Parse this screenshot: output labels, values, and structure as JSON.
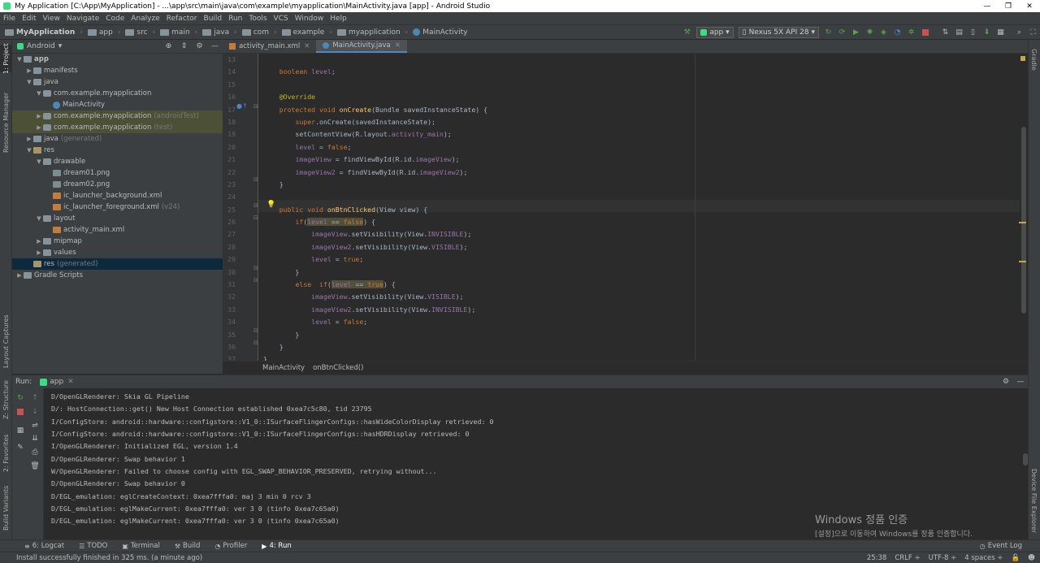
{
  "window": {
    "title": "My Application [C:\\App\\MyApplication] - ...\\app\\src\\main\\java\\com\\example\\myapplication\\MainActivity.java [app] - Android Studio"
  },
  "menu": [
    "File",
    "Edit",
    "View",
    "Navigate",
    "Code",
    "Analyze",
    "Refactor",
    "Build",
    "Run",
    "Tools",
    "VCS",
    "Window",
    "Help"
  ],
  "breadcrumbs": [
    "MyApplication",
    "app",
    "src",
    "main",
    "java",
    "com",
    "example",
    "myapplication",
    "MainActivity"
  ],
  "toolbar": {
    "run_config": "app",
    "device": "Nexus 5X API 28"
  },
  "left_tabs": [
    "1: Project",
    "Resource Manager",
    "Layout Captures",
    "Z: Structure",
    "2: Favorites",
    "Build Variants"
  ],
  "right_tabs": [
    "Gradle",
    "Device File Explorer"
  ],
  "project": {
    "view_mode": "Android",
    "tree": [
      {
        "label": "app",
        "depth": 0,
        "arrow": "▼",
        "icon": "folder",
        "bold": true
      },
      {
        "label": "manifests",
        "depth": 1,
        "arrow": "▶",
        "icon": "folder"
      },
      {
        "label": "java",
        "depth": 1,
        "arrow": "▼",
        "icon": "folder"
      },
      {
        "label": "com.example.myapplication",
        "depth": 2,
        "arrow": "▼",
        "icon": "pkg"
      },
      {
        "label": "MainActivity",
        "depth": 3,
        "arrow": "",
        "icon": "java"
      },
      {
        "label": "com.example.myapplication",
        "depth": 2,
        "arrow": "▶",
        "icon": "pkg",
        "suffix": "(androidTest)",
        "tinted": true
      },
      {
        "label": "com.example.myapplication",
        "depth": 2,
        "arrow": "▶",
        "icon": "pkg",
        "suffix": "(test)",
        "tinted": true
      },
      {
        "label": "java",
        "depth": 1,
        "arrow": "▶",
        "icon": "folder",
        "suffix": "(generated)"
      },
      {
        "label": "res",
        "depth": 1,
        "arrow": "▼",
        "icon": "res"
      },
      {
        "label": "drawable",
        "depth": 2,
        "arrow": "▼",
        "icon": "folder"
      },
      {
        "label": "dream01.png",
        "depth": 3,
        "arrow": "",
        "icon": "png"
      },
      {
        "label": "dream02.png",
        "depth": 3,
        "arrow": "",
        "icon": "png"
      },
      {
        "label": "ic_launcher_background.xml",
        "depth": 3,
        "arrow": "",
        "icon": "xml"
      },
      {
        "label": "ic_launcher_foreground.xml",
        "depth": 3,
        "arrow": "",
        "icon": "xml",
        "suffix": "(v24)"
      },
      {
        "label": "layout",
        "depth": 2,
        "arrow": "▼",
        "icon": "folder"
      },
      {
        "label": "activity_main.xml",
        "depth": 3,
        "arrow": "",
        "icon": "xml"
      },
      {
        "label": "mipmap",
        "depth": 2,
        "arrow": "▶",
        "icon": "folder"
      },
      {
        "label": "values",
        "depth": 2,
        "arrow": "▶",
        "icon": "folder"
      },
      {
        "label": "res",
        "depth": 1,
        "arrow": "",
        "icon": "res",
        "suffix": "(generated)",
        "selected": true
      },
      {
        "label": "Gradle Scripts",
        "depth": 0,
        "arrow": "▶",
        "icon": "gradle"
      }
    ]
  },
  "editor_tabs": [
    {
      "label": "activity_main.xml",
      "icon": "xml"
    },
    {
      "label": "MainActivity.java",
      "icon": "java",
      "active": true
    }
  ],
  "editor": {
    "line_numbers": [
      "13",
      "14",
      "15",
      "16",
      "17",
      "18",
      "19",
      "20",
      "21",
      "22",
      "23",
      "24",
      "25",
      "26",
      "27",
      "28",
      "29",
      "30",
      "31",
      "32",
      "33",
      "34",
      "35",
      "36",
      "37"
    ],
    "lines": [
      "",
      "    <span class=\"kw\">boolean</span> <span class=\"fd\">level</span>;",
      "",
      "    <span class=\"an\">@Override</span>",
      "    <span class=\"kw\">protected void</span> <span class=\"fn\">onCreate</span>(Bundle savedInstanceState) {",
      "        <span class=\"kw\">super</span>.onCreate(savedInstanceState);",
      "        setContentView(R.layout.<span class=\"fd\">activity_main</span>);",
      "        <span class=\"fd\">level</span> = <span class=\"kw\">false</span>;",
      "        <span class=\"fd\">imageView</span> = findViewById(R.id.<span class=\"fd\">imageView</span>);",
      "        <span class=\"fd\">imageView2</span> = findViewById(R.id.<span class=\"fd\">imageView2</span>);",
      "    }",
      "",
      "    <span class=\"kw\">public void</span> <span class=\"fn\">onBtnClicked</span>(View view) {",
      "        <span class=\"kw\">if</span>(<span class=\"hl\"><span class=\"fd\">level</span> == <span class=\"kw\">false</span></span>) {",
      "            <span class=\"fd\">imageView</span>.setVisibility(View.<span class=\"fd\">INVISIBLE</span>);",
      "            <span class=\"fd\">imageView2</span>.setVisibility(View.<span class=\"fd\">VISIBLE</span>);",
      "            <span class=\"fd\">level</span> = <span class=\"kw\">true</span>;",
      "        }",
      "        <span class=\"kw\">else</span>  <span class=\"kw\">if</span>(<span class=\"hl\"><span class=\"fd\">level</span> == <span class=\"kw\">true</span></span>) {",
      "            <span class=\"fd\">imageView</span>.setVisibility(View.<span class=\"fd\">VISIBLE</span>);",
      "            <span class=\"fd\">imageView2</span>.setVisibility(View.<span class=\"fd\">INVISIBLE</span>);",
      "            <span class=\"fd\">level</span> = <span class=\"kw\">false</span>;",
      "        }",
      "    }",
      "}"
    ]
  },
  "editor_breadcrumb": [
    "MainActivity",
    "onBtnClicked()"
  ],
  "run_panel": {
    "label": "Run:",
    "tab": "app",
    "log": [
      "D/OpenGLRenderer: Skia GL Pipeline",
      "D/: HostConnection::get() New Host Connection established 0xea7c5c80, tid 23795",
      "I/ConfigStore: android::hardware::configstore::V1_0::ISurfaceFlingerConfigs::hasWideColorDisplay retrieved: 0",
      "I/ConfigStore: android::hardware::configstore::V1_0::ISurfaceFlingerConfigs::hasHDRDisplay retrieved: 0",
      "I/OpenGLRenderer: Initialized EGL, version 1.4",
      "D/OpenGLRenderer: Swap behavior 1",
      "W/OpenGLRenderer: Failed to choose config with EGL_SWAP_BEHAVIOR_PRESERVED, retrying without...",
      "D/OpenGLRenderer: Swap behavior 0",
      "D/EGL_emulation: eglCreateContext: 0xea7fffa0: maj 3 min 0 rcv 3",
      "D/EGL_emulation: eglMakeCurrent: 0xea7fffa0: ver 3 0 (tinfo 0xea7c65a0)",
      "D/EGL_emulation: eglMakeCurrent: 0xea7fffa0: ver 3 0 (tinfo 0xea7c65a0)"
    ]
  },
  "watermark": {
    "line1": "Windows 정품 인증",
    "line2": "[설정]으로 이동하여 Windows를 정품 인증합니다."
  },
  "bottom_tabs": [
    {
      "label": "6: Logcat",
      "icon": "≡"
    },
    {
      "label": "TODO",
      "icon": "☰"
    },
    {
      "label": "Terminal",
      "icon": "▣"
    },
    {
      "label": "Build",
      "icon": "⚒"
    },
    {
      "label": "Profiler",
      "icon": "◔"
    },
    {
      "label": "4: Run",
      "icon": "▶",
      "active": true
    }
  ],
  "event_log": "Event Log",
  "status": {
    "message": "Install successfully finished in 325 ms. (a minute ago)",
    "position": "25:38",
    "line_sep": "CRLF ÷",
    "encoding": "UTF-8 ÷",
    "indent": "4 spaces ÷"
  }
}
